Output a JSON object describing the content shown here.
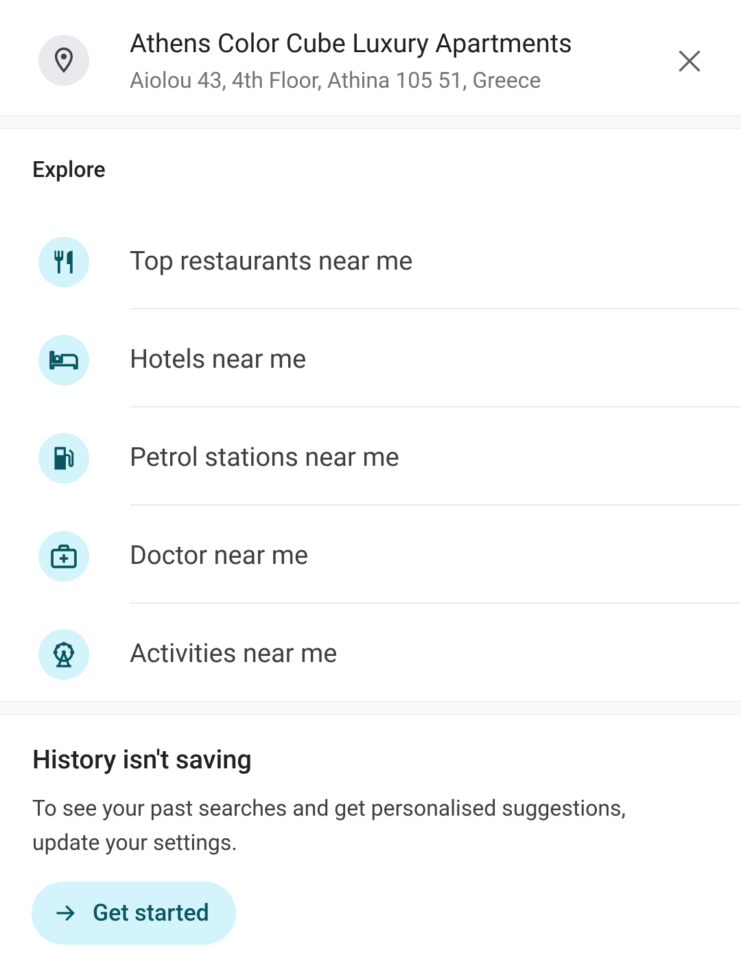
{
  "place": {
    "title": "Athens Color Cube Luxury Apartments",
    "address": "Aiolou 43, 4th Floor, Athina 105 51, Greece",
    "icon": "location-pin-icon",
    "close_icon": "close-icon"
  },
  "explore": {
    "heading": "Explore",
    "items": [
      {
        "label": "Top restaurants near me",
        "icon": "restaurant-icon"
      },
      {
        "label": "Hotels near me",
        "icon": "hotel-bed-icon"
      },
      {
        "label": "Petrol stations near me",
        "icon": "fuel-pump-icon"
      },
      {
        "label": "Doctor near me",
        "icon": "medical-bag-icon"
      },
      {
        "label": "Activities near me",
        "icon": "ferris-wheel-icon"
      }
    ]
  },
  "history": {
    "heading": "History isn't saving",
    "body": "To see your past searches and get personalised suggestions, update your settings.",
    "cta_label": "Get started",
    "cta_icon": "arrow-right-icon"
  },
  "colors": {
    "accent_bg": "#d3f4fb",
    "accent_icon": "#0b5560",
    "divider": "#e8eaed"
  }
}
